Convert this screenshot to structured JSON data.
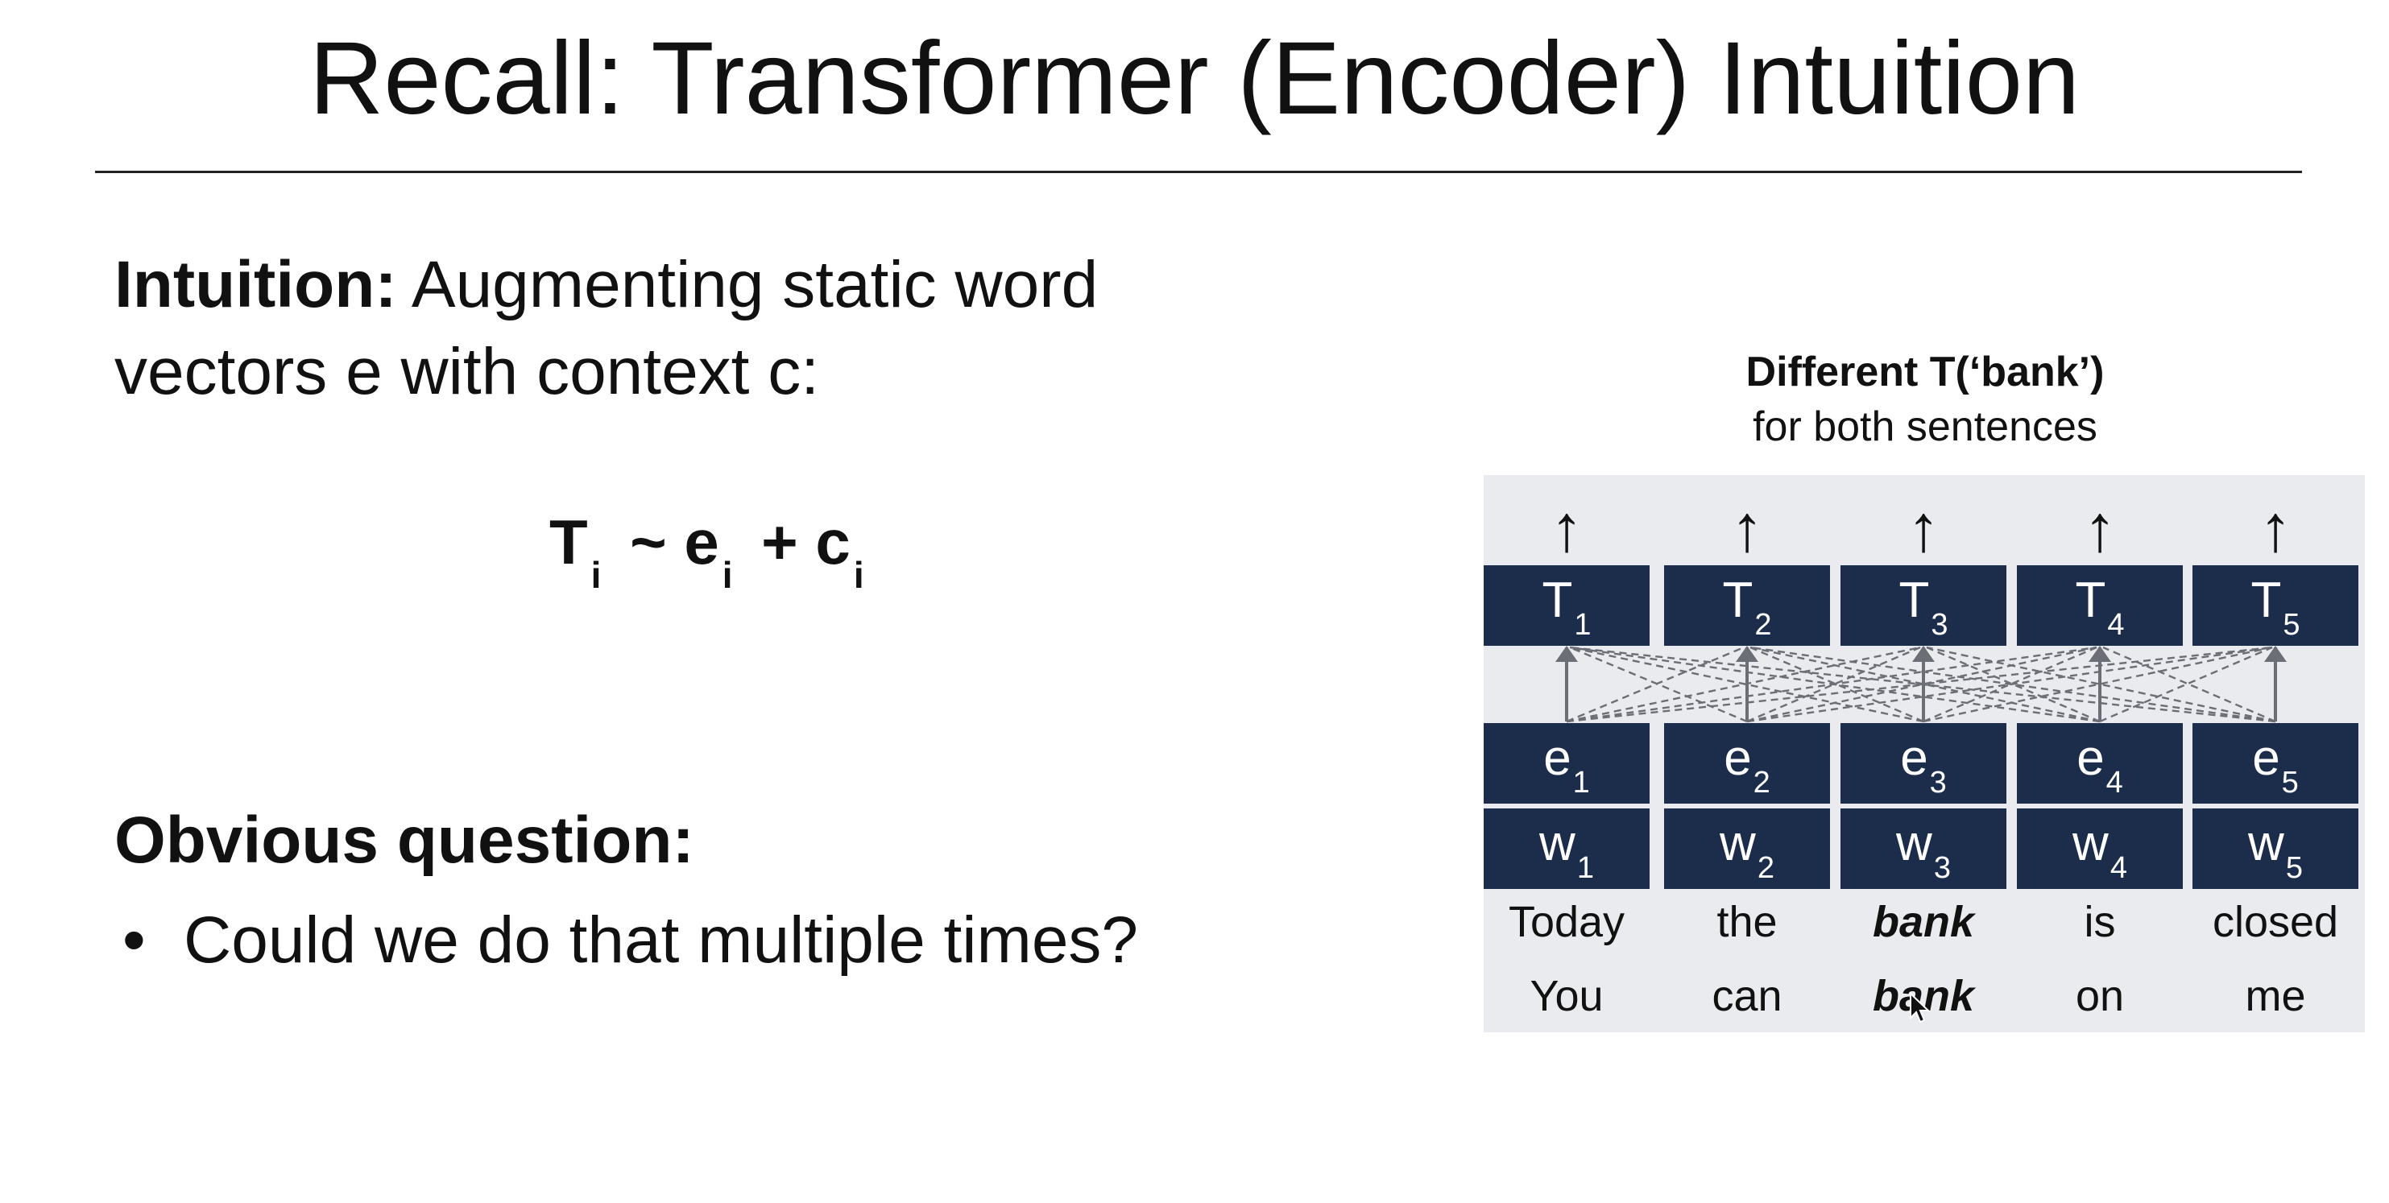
{
  "slide": {
    "title": "Recall: Transformer (Encoder) Intuition",
    "intuition_label": "Intuition:",
    "intuition_text": " Augmenting static word vectors e with context c:",
    "formula": {
      "T": "T",
      "i": "i",
      "tilde": " ~ ",
      "e": "e",
      "plus": " + ",
      "c": "c"
    },
    "question_label": "Obvious question:",
    "bullet_symbol": "•",
    "bullet_text": "Could we do that multiple times?"
  },
  "diagram": {
    "caption_bold": "Different T(‘bank’)",
    "caption_normal": "for both sentences",
    "up_arrow": "↑",
    "columns": [
      {
        "T": "T",
        "T_sub": "1",
        "e": "e",
        "e_sub": "1",
        "w": "w",
        "w_sub": "1",
        "word1": "Today",
        "word2": "You"
      },
      {
        "T": "T",
        "T_sub": "2",
        "e": "e",
        "e_sub": "2",
        "w": "w",
        "w_sub": "2",
        "word1": "the",
        "word2": "can"
      },
      {
        "T": "T",
        "T_sub": "3",
        "e": "e",
        "e_sub": "3",
        "w": "w",
        "w_sub": "3",
        "word1": "bank",
        "word2": "bank"
      },
      {
        "T": "T",
        "T_sub": "4",
        "e": "e",
        "e_sub": "4",
        "w": "w",
        "w_sub": "4",
        "word1": "is",
        "word2": "on"
      },
      {
        "T": "T",
        "T_sub": "5",
        "e": "e",
        "e_sub": "5",
        "w": "w",
        "w_sub": "5",
        "word1": "closed",
        "word2": "me"
      }
    ],
    "colors": {
      "box": "#1b2d4b",
      "panel": "#eaebef",
      "connection": "#6b6e75"
    }
  }
}
